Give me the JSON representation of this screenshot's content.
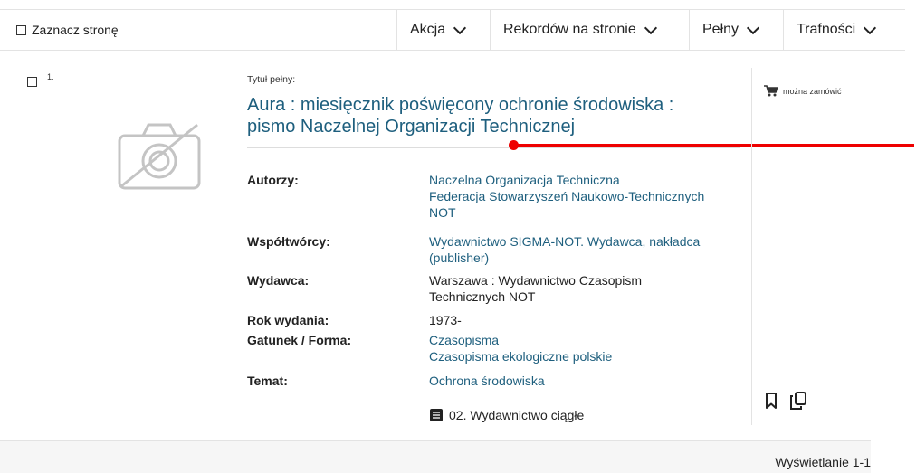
{
  "toolbar": {
    "select_page": "Zaznacz stronę",
    "action": "Akcja",
    "records_per_page": "Rekordów na stronie",
    "view": "Pełny",
    "sort": "Trafności"
  },
  "record": {
    "number": "1.",
    "title_label": "Tytuł pełny:",
    "title_line1": "Aura : miesięcznik poświęcony ochronie środowiska :",
    "title_line2": "pismo Naczelnej Organizacji Technicznej",
    "fields": {
      "authors_label": "Autorzy:",
      "authors": [
        "Naczelna Organizacja Techniczna",
        "Federacja Stowarzyszeń Naukowo-Technicznych",
        "NOT"
      ],
      "contributors_label": "Współtwórcy:",
      "contributors": [
        "Wydawnictwo SIGMA-NOT. Wydawca, nakładca",
        "(publisher)"
      ],
      "publisher_label": "Wydawca:",
      "publisher": [
        "Warszawa : Wydawnictwo Czasopism",
        "Technicznych NOT"
      ],
      "year_label": "Rok wydania:",
      "year": "1973-",
      "genre_label": "Gatunek / Forma:",
      "genre": [
        "Czasopisma",
        "Czasopisma ekologiczne polskie"
      ],
      "subject_label": "Temat:",
      "subject": "Ochrona środowiska"
    },
    "format": "02. Wydawnictwo ciągłe",
    "availability": "można zamówić"
  },
  "footer": {
    "showing": "Wyświetlanie 1-1"
  },
  "colors": {
    "link": "#1e5f7e",
    "annotation": "#e00000"
  }
}
